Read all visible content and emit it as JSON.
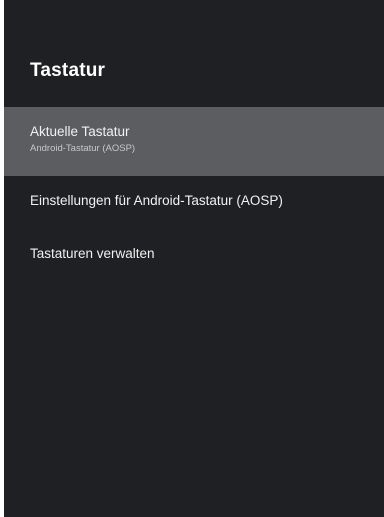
{
  "screen": {
    "title": "Tastatur"
  },
  "items": [
    {
      "label": "Aktuelle Tastatur",
      "sublabel": "Android-Tastatur (AOSP)",
      "selected": true
    },
    {
      "label": "Einstellungen für Android-Tastatur (AOSP)"
    },
    {
      "label": "Tastaturen verwalten"
    }
  ],
  "colors": {
    "background": "#1f2023",
    "selected_row": "#5b5d61",
    "text_primary": "#f1f1f1",
    "text_secondary": "#c8c8c8"
  }
}
